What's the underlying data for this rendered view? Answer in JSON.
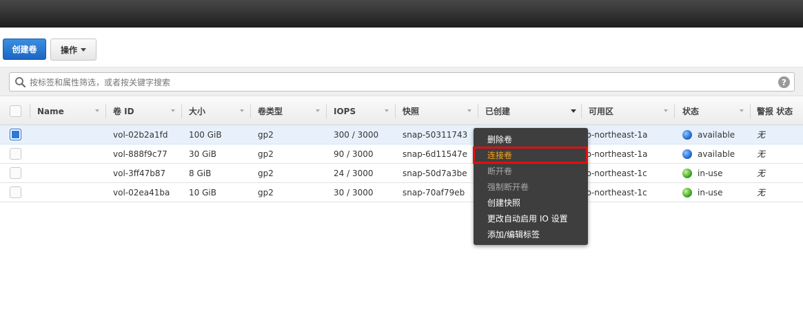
{
  "toolbar": {
    "create_label": "创建卷",
    "actions_label": "操作"
  },
  "search": {
    "placeholder": "按标签和属性筛选，或者按关键字搜索",
    "help": "?"
  },
  "table": {
    "columns": [
      "Name",
      "卷 ID",
      "大小",
      "卷类型",
      "IOPS",
      "快照",
      "已创建",
      "可用区",
      "状态",
      "警报 状态"
    ],
    "rows": [
      {
        "name": "",
        "volume_id": "vol-02b2a1fd",
        "size": "100 GiB",
        "type": "gp2",
        "iops": "300 / 3000",
        "snapshot": "snap-50311743",
        "zone": "ap-northeast-1a",
        "state": "available",
        "state_color": "blue",
        "alarm": "无",
        "selected": true
      },
      {
        "name": "",
        "volume_id": "vol-888f9c77",
        "size": "30 GiB",
        "type": "gp2",
        "iops": "90 / 3000",
        "snapshot": "snap-6d11547e",
        "zone": "ap-northeast-1a",
        "state": "available",
        "state_color": "blue",
        "alarm": "无",
        "selected": false
      },
      {
        "name": "",
        "volume_id": "vol-3ff47b87",
        "size": "8 GiB",
        "type": "gp2",
        "iops": "24 / 3000",
        "snapshot": "snap-50d7a3be",
        "zone": "ap-northeast-1c",
        "state": "in-use",
        "state_color": "green",
        "alarm": "无",
        "selected": false
      },
      {
        "name": "",
        "volume_id": "vol-02ea41ba",
        "size": "10 GiB",
        "type": "gp2",
        "iops": "30 / 3000",
        "snapshot": "snap-70af79eb",
        "zone": "ap-northeast-1c",
        "state": "in-use",
        "state_color": "green",
        "alarm": "无",
        "selected": false
      }
    ]
  },
  "context_menu": {
    "items": [
      {
        "label": "删除卷",
        "state": "enabled"
      },
      {
        "label": "连接卷",
        "state": "highlighted"
      },
      {
        "label": "断开卷",
        "state": "disabled"
      },
      {
        "label": "强制断开卷",
        "state": "disabled"
      },
      {
        "label": "创建快照",
        "state": "enabled"
      },
      {
        "label": "更改自动启用 IO 设置",
        "state": "enabled"
      },
      {
        "label": "添加/编辑标签",
        "state": "enabled"
      }
    ]
  },
  "colors": {
    "primary_button": "#1b66c4",
    "highlight_text": "#f7a21c",
    "highlight_border": "#e01010",
    "menu_background": "#3e3e3e"
  }
}
